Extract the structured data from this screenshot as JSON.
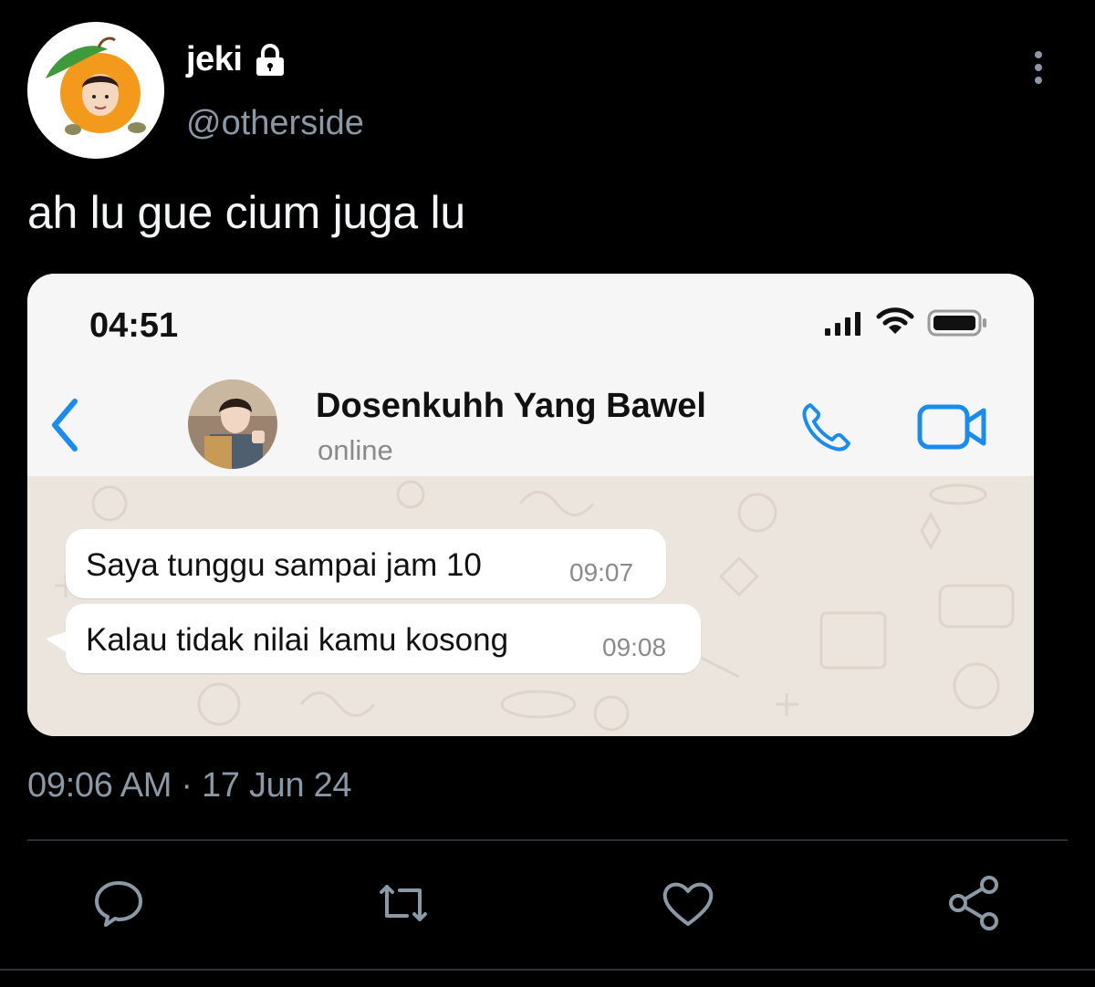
{
  "tweet": {
    "display_name": "jeki",
    "handle": "@otherside",
    "text": "ah lu gue cium juga lu",
    "timestamp": "09:06 AM · 17 Jun 24",
    "locked": true
  },
  "screenshot": {
    "status_time": "04:51",
    "contact_name": "Dosenkuhh Yang Bawel",
    "contact_status": "online",
    "messages": [
      {
        "text": "Saya tunggu sampai jam 10",
        "time": "09:07"
      },
      {
        "text": "Kalau tidak nilai kamu kosong",
        "time": "09:08"
      }
    ]
  },
  "icons": {
    "lock": "lock-icon",
    "more": "more-vertical-icon",
    "back": "chevron-left-icon",
    "call": "phone-icon",
    "video": "video-camera-icon",
    "reply": "speech-bubble-icon",
    "retweet": "retweet-icon",
    "like": "heart-icon",
    "share": "share-icon"
  },
  "colors": {
    "background": "#000000",
    "secondary_text": "#8b98a5",
    "whatsapp_blue": "#1a8cf0",
    "chat_bg": "#ebe5dd"
  }
}
